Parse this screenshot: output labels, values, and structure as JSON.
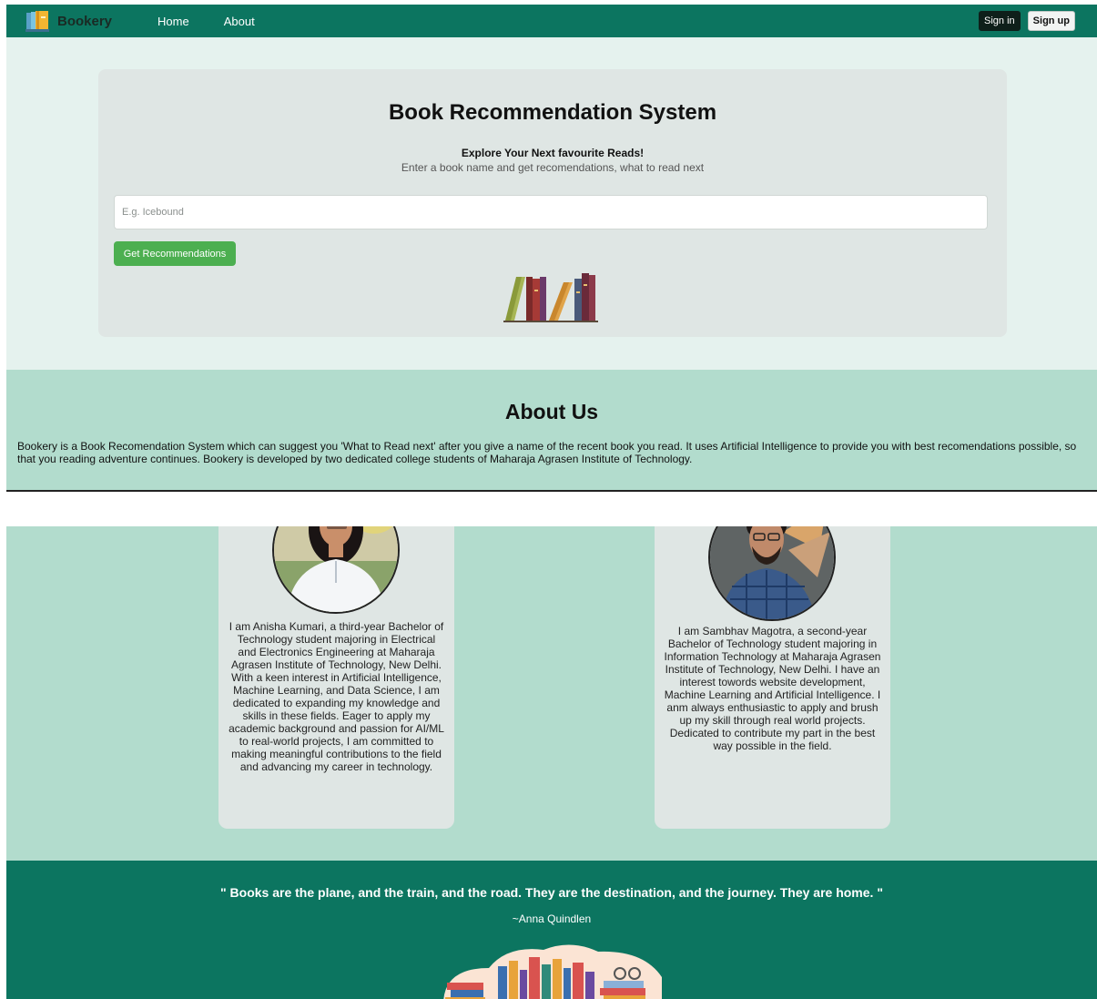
{
  "navbar": {
    "brand": "Bookery",
    "links": [
      "Home",
      "About"
    ],
    "sign_in": "Sign in",
    "sign_up": "Sign up"
  },
  "hero": {
    "title": "Book Recommendation System",
    "subtitle": "Explore Your Next favourite Reads!",
    "description": "Enter a book name and get recomendations, what to read next",
    "search_placeholder": "E.g. Icebound",
    "search_value": "",
    "button_label": "Get Recommendations"
  },
  "about": {
    "title": "About Us",
    "text": "Bookery is a Book Recomendation System which can suggest you 'What to Read next' after you give a name of the recent book you read. It uses Artificial Intelligence to provide you with best recomendations possible, so that you reading adventure continues. Bookery is developed by two dedicated college students of Maharaja Agrasen Institute of Technology."
  },
  "team": [
    {
      "bio": "I am Anisha Kumari, a third-year Bachelor of Technology student majoring in Electrical and Electronics Engineering at Maharaja Agrasen Institute of Technology, New Delhi. With a keen interest in Artificial Intelligence, Machine Learning, and Data Science, I am dedicated to expanding my knowledge and skills in these fields. Eager to apply my academic background and passion for AI/ML to real-world projects, I am committed to making meaningful contributions to the field and advancing my career in technology."
    },
    {
      "bio": "I am Sambhav Magotra, a second-year Bachelor of Technology student majoring in Information Technology at Maharaja Agrasen Institute of Technology, New Delhi. I have an interest towords website development, Machine Learning and Artificial Intelligence. I anm always enthusiastic to apply and brush up my skill through real world projects. Dedicated to contribute my part in the best way possible in the field."
    }
  ],
  "footer": {
    "quote": "\" Books are the plane, and the train, and the road. They are the destination, and the journey. They are home. \"",
    "author": "~Anna Quindlen"
  },
  "colors": {
    "primary": "#0c7560",
    "button_green": "#4caf50",
    "hero_bg": "#e5f2ee",
    "card_bg": "#dfe6e4",
    "about_bg": "#b2dccd"
  },
  "icons": [
    "book-logo-icon",
    "books-illustration",
    "footer-books-illustration"
  ]
}
